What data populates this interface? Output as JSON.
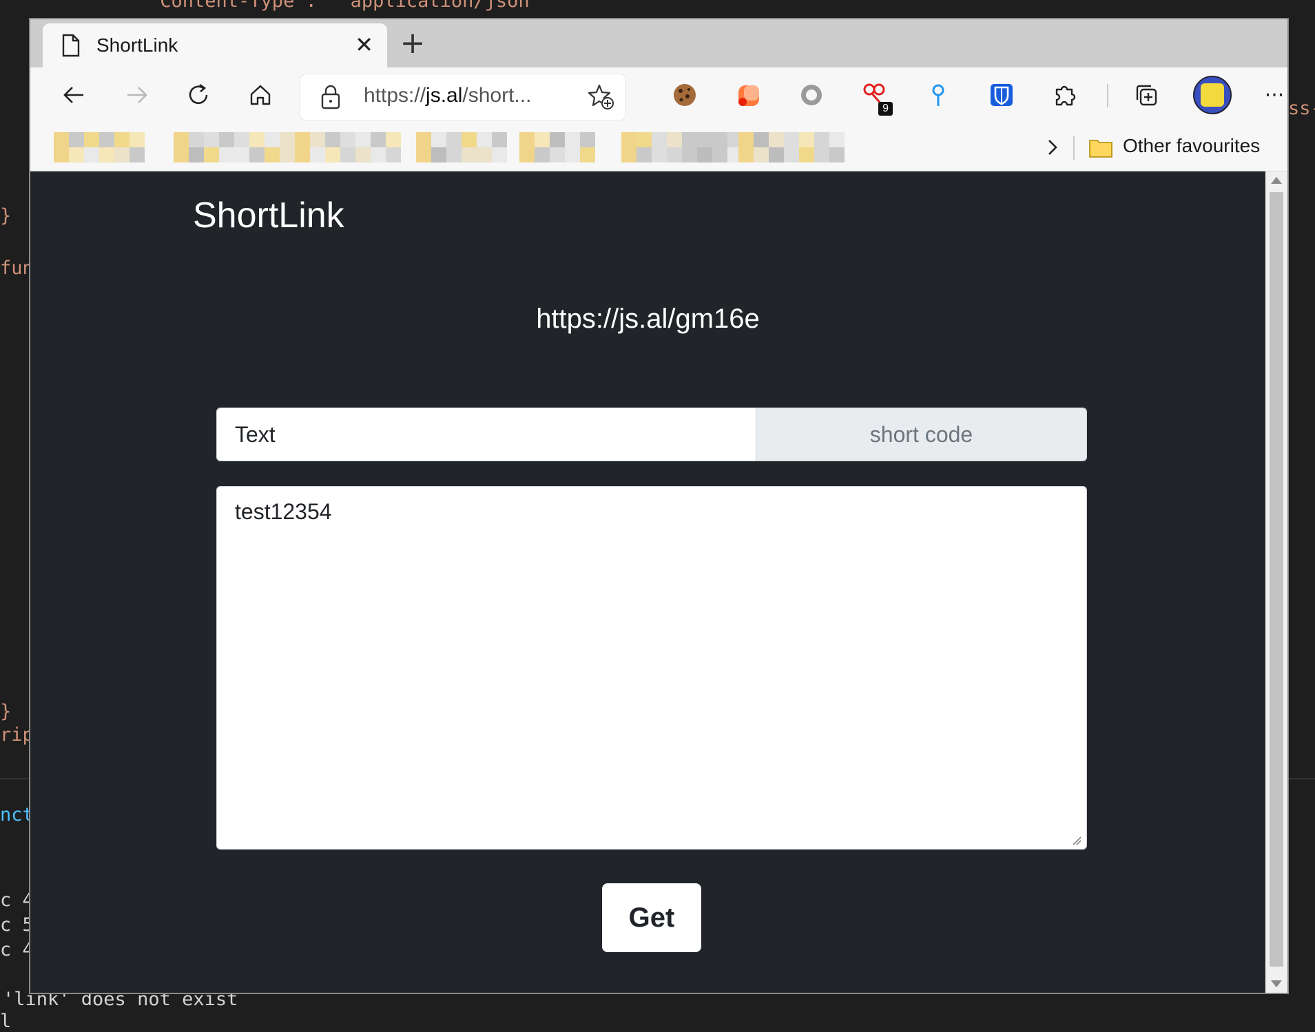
{
  "editor": {
    "top_line": "\"Content-Type\":  \"application/json\"",
    "fragments": [
      "}",
      "fun",
      "}",
      "rip",
      "nct",
      "c 4",
      "c 5",
      "c 4",
      "'link' does not exist",
      "l"
    ],
    "right_fragment": "ss-"
  },
  "browser": {
    "tab": {
      "title": "ShortLink",
      "close_glyph": "✕"
    },
    "new_tab_glyph": "+",
    "address": {
      "scheme": "https://",
      "host": "js.al",
      "path": "/short..."
    },
    "extensions": [
      {
        "name": "cookie-extension-icon"
      },
      {
        "name": "orange-extension-icon"
      },
      {
        "name": "gray-circle-extension-icon"
      },
      {
        "name": "red-extension-icon",
        "badge": "9"
      },
      {
        "name": "pin-extension-icon"
      },
      {
        "name": "bitwarden-icon"
      },
      {
        "name": "puzzle-extensions-icon"
      },
      {
        "name": "collections-icon"
      }
    ],
    "more_glyph": "···",
    "favourites": {
      "other_label": "Other favourites"
    }
  },
  "page": {
    "title": "ShortLink",
    "result_link": "https://js.al/gm16e",
    "type_input": {
      "value": "Text"
    },
    "short_code_addon": "short code",
    "content": "test12354",
    "get_button": "Get"
  },
  "colors": {
    "page_bg": "#212529",
    "editor_bg": "#1e1e1e",
    "code_string": "#ce9178",
    "code_keyword": "#4fc1ff"
  }
}
